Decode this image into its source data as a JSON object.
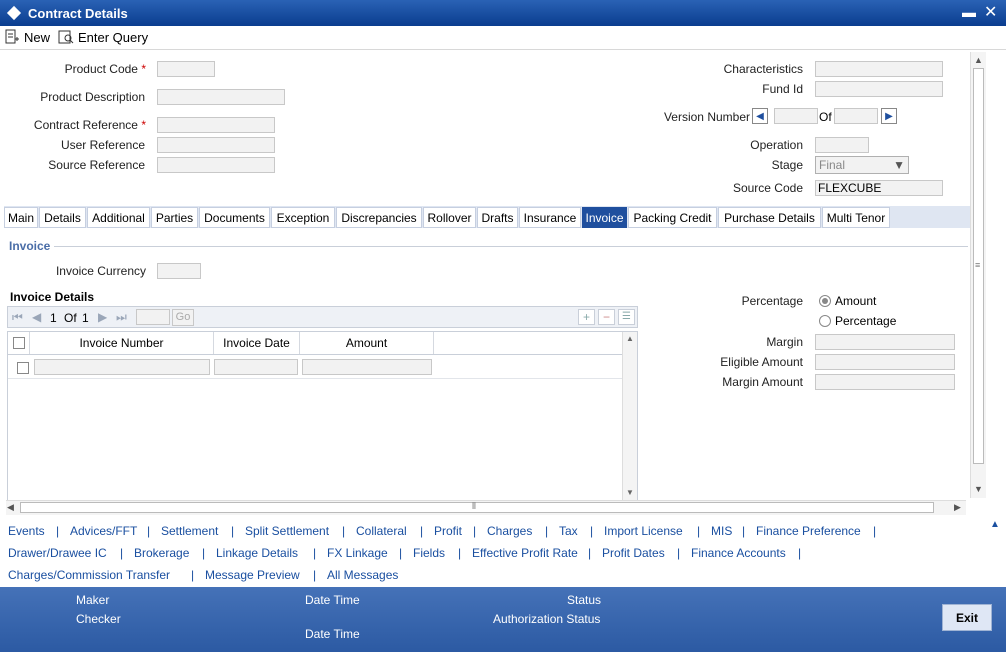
{
  "window": {
    "title": "Contract Details"
  },
  "toolbar": {
    "new_label": "New",
    "enter_query_label": "Enter Query"
  },
  "header": {
    "product_code_label": "Product Code",
    "product_description_label": "Product Description",
    "contract_reference_label": "Contract Reference",
    "user_reference_label": "User Reference",
    "source_reference_label": "Source Reference",
    "characteristics_label": "Characteristics",
    "fund_id_label": "Fund Id",
    "version_number_label": "Version Number",
    "of_label": "Of",
    "operation_label": "Operation",
    "stage_label": "Stage",
    "stage_value": "Final",
    "source_code_label": "Source Code",
    "source_code_value": "FLEXCUBE",
    "required_mark": "*"
  },
  "tabs": [
    "Main",
    "Details",
    "Additional",
    "Parties",
    "Documents",
    "Exception",
    "Discrepancies",
    "Rollover",
    "Drafts",
    "Insurance",
    "Invoice",
    "Packing Credit",
    "Purchase Details",
    "Multi Tenor"
  ],
  "active_tab": "Invoice",
  "invoice": {
    "section_title": "Invoice",
    "currency_label": "Invoice Currency",
    "details_title": "Invoice Details",
    "pager": {
      "current": "1",
      "of_label": "Of",
      "total": "1",
      "go_label": "Go"
    },
    "columns": [
      "Invoice Number",
      "Invoice Date",
      "Amount"
    ],
    "percentage_label": "Percentage",
    "radio_amount": "Amount",
    "radio_percentage": "Percentage",
    "margin_label": "Margin",
    "eligible_amount_label": "Eligible Amount",
    "margin_amount_label": "Margin Amount"
  },
  "links": {
    "row1": [
      "Events",
      "Advices/FFT",
      "Settlement",
      "Split Settlement",
      "Collateral",
      "Profit",
      "Charges",
      "Tax",
      "Import License",
      "MIS",
      "Finance Preference"
    ],
    "row2": [
      "Drawer/Drawee IC",
      "Brokerage",
      "Linkage Details",
      "FX Linkage",
      "Fields",
      "Effective Profit Rate",
      "Profit Dates",
      "Finance Accounts"
    ],
    "row3": [
      "Charges/Commission Transfer",
      "Message Preview",
      "All Messages"
    ],
    "separator": "|"
  },
  "footer": {
    "maker_label": "Maker",
    "checker_label": "Checker",
    "date_time_label": "Date Time",
    "status_label": "Status",
    "authorization_status_label": "Authorization Status",
    "exit_label": "Exit"
  }
}
